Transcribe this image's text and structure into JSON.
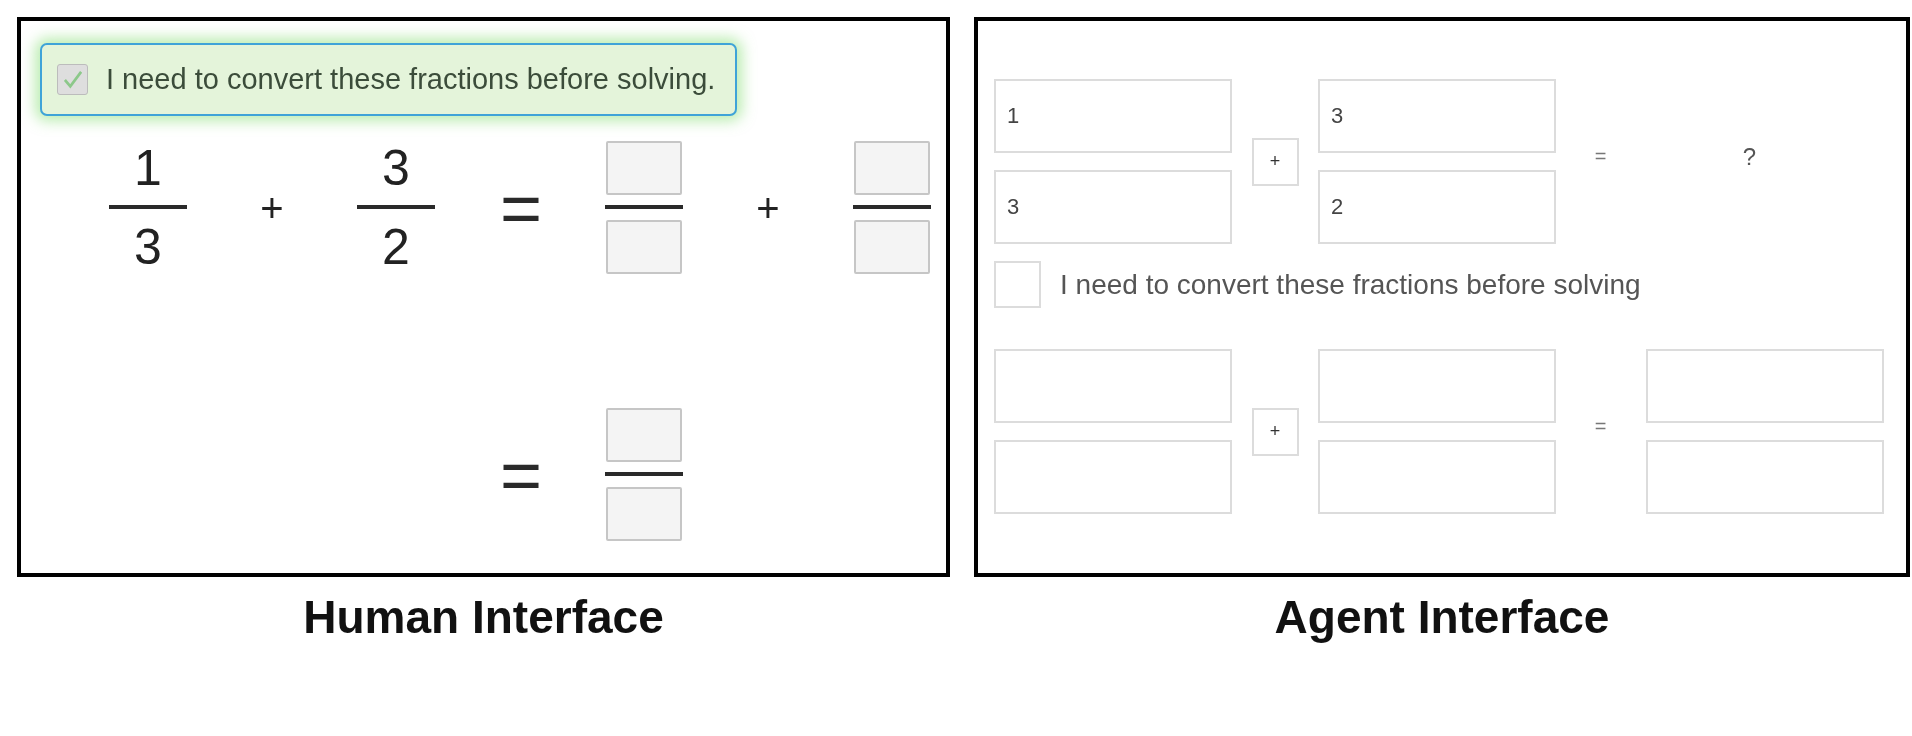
{
  "panels": [
    {
      "kind": "human",
      "caption": "Human Interface",
      "items": [
        {
          "kind": "hint",
          "label": "I need to convert these fractions before solving.",
          "checked": true,
          "highlighted": true
        },
        {
          "kind": "equation",
          "terms": [
            {
              "kind": "fraction",
              "numerator": "1",
              "denominator": "3"
            },
            {
              "kind": "operator",
              "symbol": "+"
            },
            {
              "kind": "fraction",
              "numerator": "3",
              "denominator": "2"
            },
            {
              "kind": "equals",
              "symbol": "="
            },
            {
              "kind": "blank_fraction"
            },
            {
              "kind": "operator",
              "symbol": "+"
            },
            {
              "kind": "blank_fraction"
            }
          ]
        },
        {
          "kind": "equation",
          "terms": [
            {
              "kind": "equals",
              "symbol": "="
            },
            {
              "kind": "blank_fraction"
            }
          ]
        }
      ]
    },
    {
      "kind": "agent",
      "caption": "Agent Interface",
      "items": [
        {
          "kind": "equation",
          "terms": [
            {
              "kind": "fraction",
              "numerator": "1",
              "denominator": "3"
            },
            {
              "kind": "operator",
              "symbol": "+"
            },
            {
              "kind": "fraction",
              "numerator": "3",
              "denominator": "2"
            },
            {
              "kind": "equals",
              "symbol": "="
            },
            {
              "kind": "unknown",
              "symbol": "?"
            }
          ]
        },
        {
          "kind": "hint",
          "label": "I need to convert these fractions before solving",
          "checked": false,
          "highlighted": false
        },
        {
          "kind": "equation",
          "terms": [
            {
              "kind": "blank_fraction"
            },
            {
              "kind": "operator",
              "symbol": "+"
            },
            {
              "kind": "blank_fraction"
            },
            {
              "kind": "equals",
              "symbol": "="
            },
            {
              "kind": "blank_fraction"
            }
          ]
        }
      ]
    }
  ]
}
